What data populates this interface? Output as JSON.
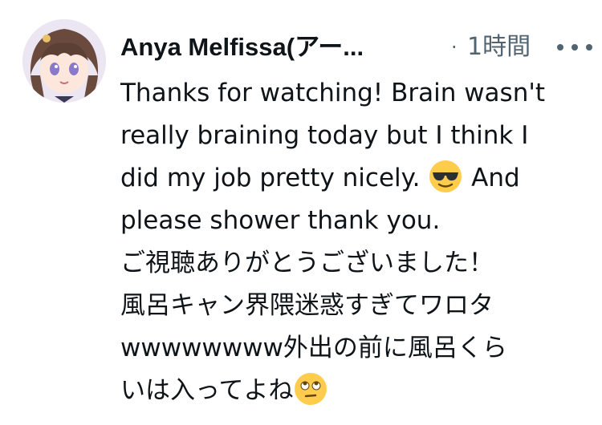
{
  "author": {
    "display_name": "Anya Melfissa(アー..."
  },
  "meta": {
    "separator": "·",
    "timestamp": "1時間"
  },
  "icons": {
    "more": "more-horizontal-icon",
    "sunglasses_emoji": "smiling-face-with-sunglasses-emoji",
    "eye_roll_emoji": "face-with-rolling-eyes-emoji"
  },
  "tweet": {
    "line_1": "Thanks for watching! Brain wasn't",
    "line_2": "really braining today but I think I",
    "line_3a": "did my job pretty nicely. ",
    "line_3b": " And",
    "line_4": "please shower thank you.",
    "line_5": "ご視聴ありがとうございました！",
    "line_6": "風呂キャン界隈迷惑すぎてワロタ",
    "line_7": "wwwwwwww外出の前に風呂くら",
    "line_8": "いは入ってよね"
  },
  "colors": {
    "text": "#0f1419",
    "secondary": "#536471",
    "emoji_yellow": "#ffcc4d"
  }
}
